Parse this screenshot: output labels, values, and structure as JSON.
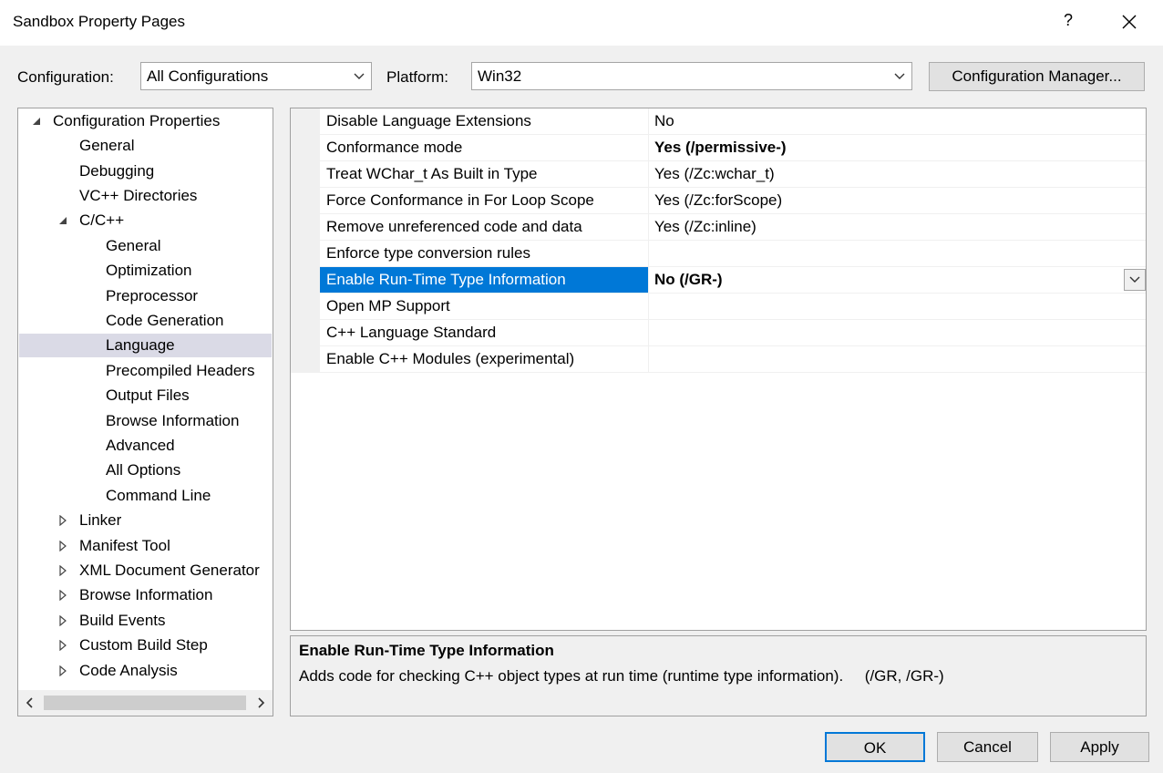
{
  "window": {
    "title": "Sandbox Property Pages",
    "help_label": "?"
  },
  "config_bar": {
    "configuration_label": "Configuration:",
    "configuration_value": "All Configurations",
    "platform_label": "Platform:",
    "platform_value": "Win32",
    "manager_button": "Configuration Manager..."
  },
  "tree": {
    "root": "Configuration Properties",
    "items": [
      {
        "label": "General"
      },
      {
        "label": "Debugging"
      },
      {
        "label": "VC++ Directories"
      },
      {
        "label": "C/C++"
      },
      {
        "label": "General"
      },
      {
        "label": "Optimization"
      },
      {
        "label": "Preprocessor"
      },
      {
        "label": "Code Generation"
      },
      {
        "label": "Language"
      },
      {
        "label": "Precompiled Headers"
      },
      {
        "label": "Output Files"
      },
      {
        "label": "Browse Information"
      },
      {
        "label": "Advanced"
      },
      {
        "label": "All Options"
      },
      {
        "label": "Command Line"
      },
      {
        "label": "Linker"
      },
      {
        "label": "Manifest Tool"
      },
      {
        "label": "XML Document Generator"
      },
      {
        "label": "Browse Information"
      },
      {
        "label": "Build Events"
      },
      {
        "label": "Custom Build Step"
      },
      {
        "label": "Code Analysis"
      }
    ],
    "selected": "Language"
  },
  "properties": [
    {
      "name": "Disable Language Extensions",
      "value": "No"
    },
    {
      "name": "Conformance mode",
      "value": "Yes (/permissive-)"
    },
    {
      "name": "Treat WChar_t As Built in Type",
      "value": "Yes (/Zc:wchar_t)"
    },
    {
      "name": "Force Conformance in For Loop Scope",
      "value": "Yes (/Zc:forScope)"
    },
    {
      "name": "Remove unreferenced code and data",
      "value": "Yes (/Zc:inline)"
    },
    {
      "name": "Enforce type conversion rules",
      "value": ""
    },
    {
      "name": "Enable Run-Time Type Information",
      "value": "No (/GR-)"
    },
    {
      "name": "Open MP Support",
      "value": ""
    },
    {
      "name": "C++ Language Standard",
      "value": ""
    },
    {
      "name": "Enable C++ Modules (experimental)",
      "value": ""
    }
  ],
  "description": {
    "title": "Enable Run-Time Type Information",
    "text": "Adds code for checking C++ object types at run time (runtime type information).     (/GR, /GR-)"
  },
  "buttons": {
    "ok": "OK",
    "cancel": "Cancel",
    "apply": "Apply"
  },
  "colors": {
    "selection_blue": "#0078d7",
    "tree_selection": "#dadae6",
    "dialog_bg": "#f0f0f0"
  }
}
